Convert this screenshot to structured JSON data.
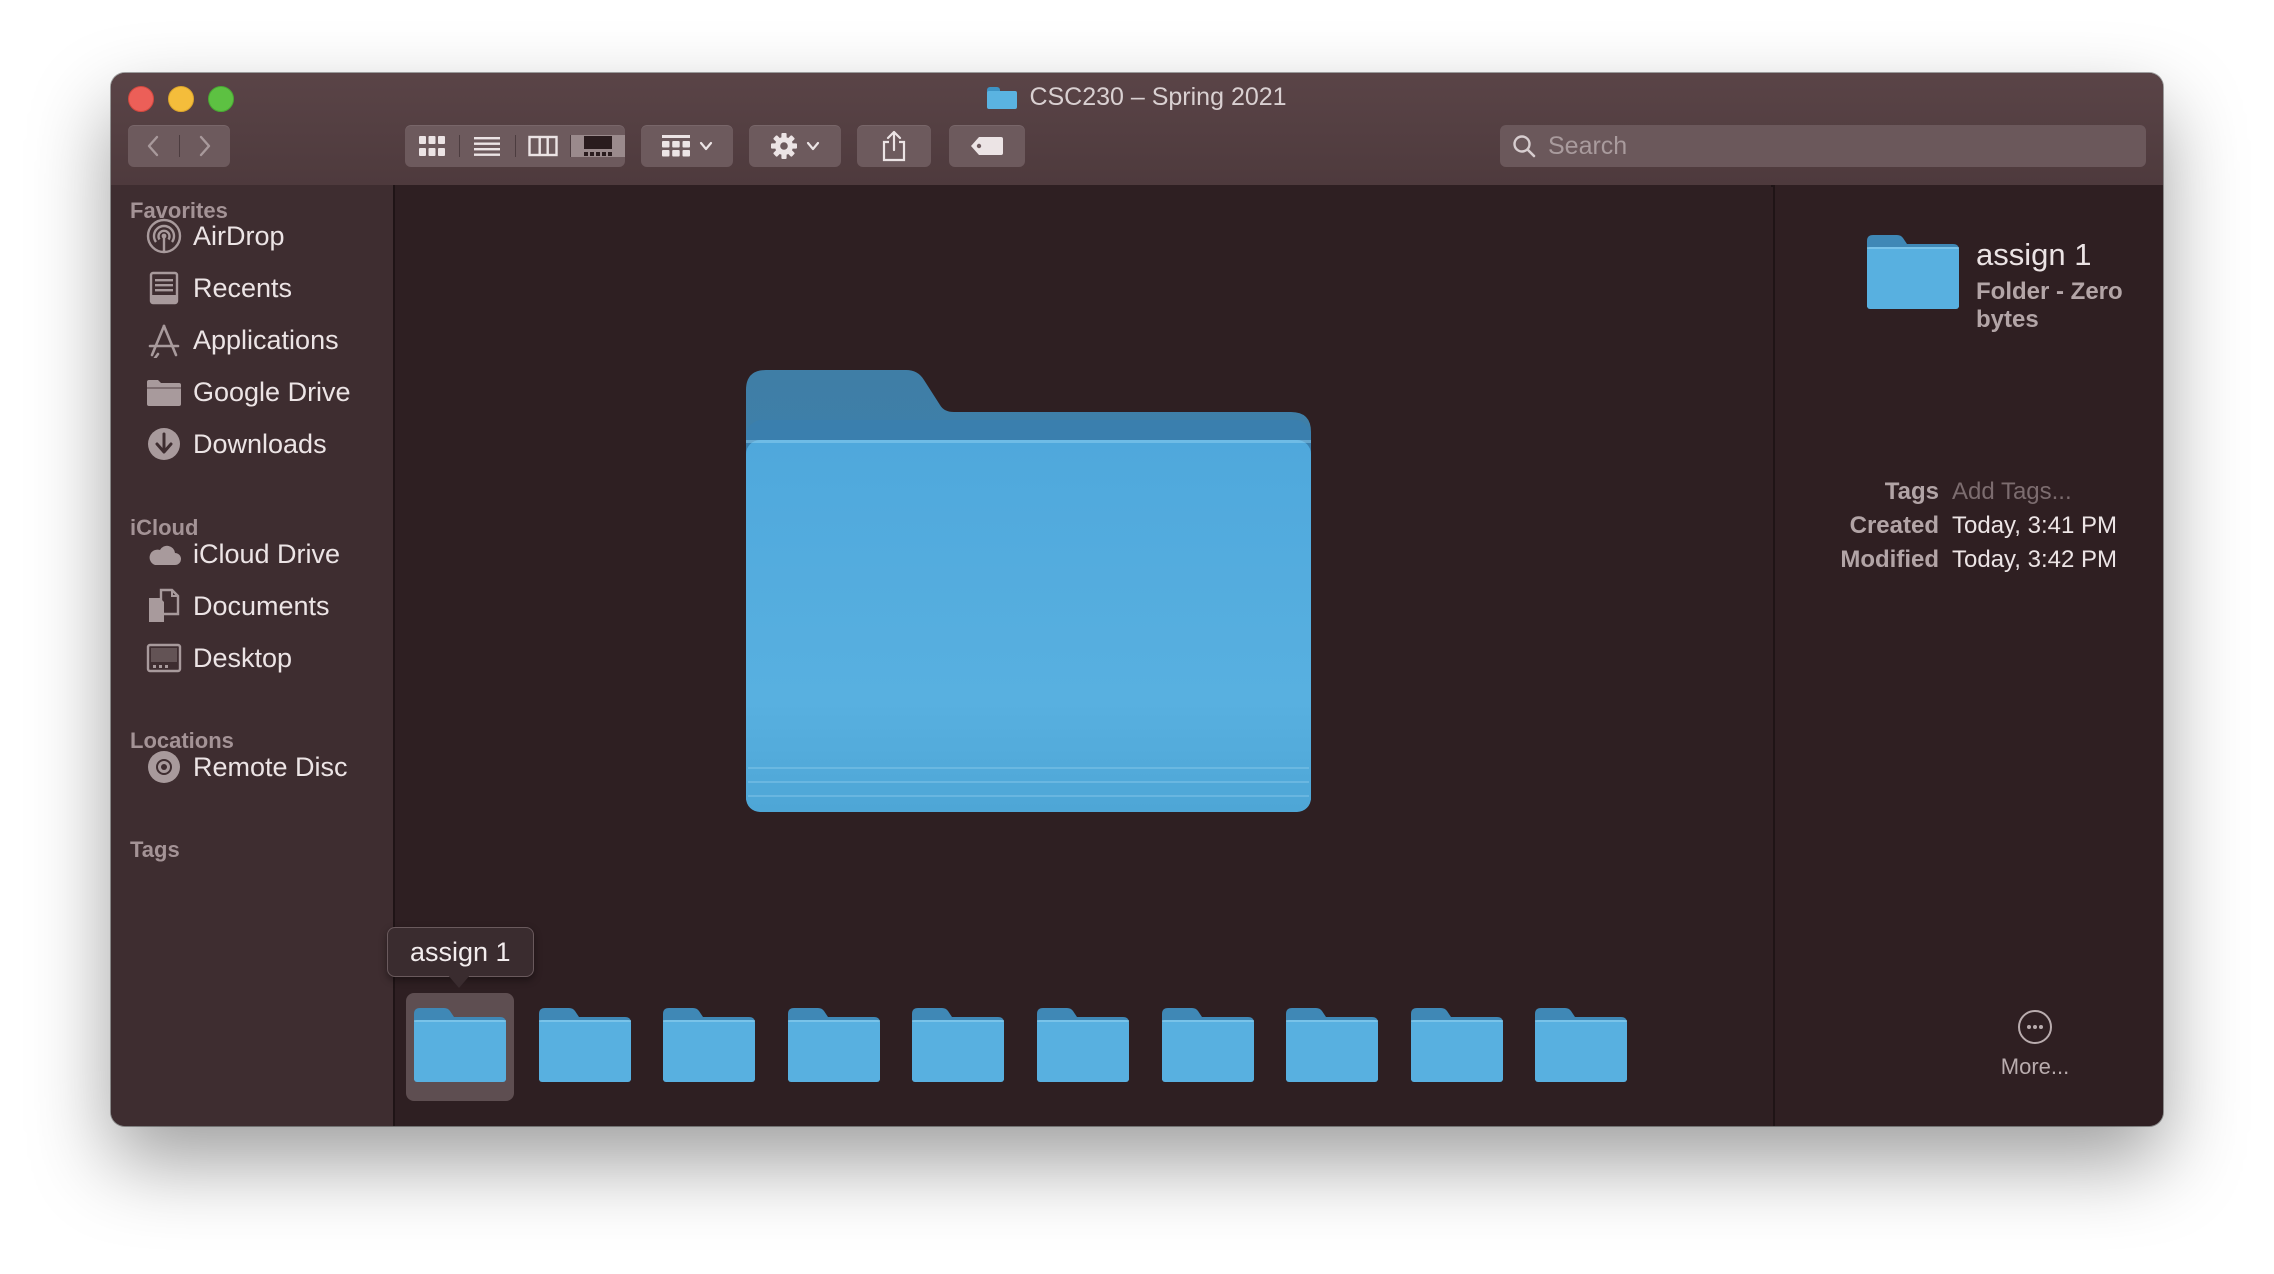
{
  "window": {
    "title": "CSC230 – Spring 2021",
    "title_icon": "folder-icon"
  },
  "toolbar": {
    "back_icon": "chevron-left-icon",
    "forward_icon": "chevron-right-icon",
    "view_modes": [
      {
        "id": "icon",
        "icon": "grid-icon",
        "active": false
      },
      {
        "id": "list",
        "icon": "list-icon",
        "active": false
      },
      {
        "id": "columns",
        "icon": "columns-icon",
        "active": false
      },
      {
        "id": "gallery",
        "icon": "gallery-icon",
        "active": true
      }
    ],
    "group_icon": "group-grid-icon",
    "action_icon": "gear-icon",
    "share_icon": "share-icon",
    "tag_icon": "tag-icon",
    "search_placeholder": "Search"
  },
  "sidebar": {
    "sections": [
      {
        "header": "Favorites",
        "items": [
          {
            "label": "AirDrop",
            "icon": "airdrop-icon"
          },
          {
            "label": "Recents",
            "icon": "recents-icon"
          },
          {
            "label": "Applications",
            "icon": "applications-icon"
          },
          {
            "label": "Google Drive",
            "icon": "folder-icon"
          },
          {
            "label": "Downloads",
            "icon": "downloads-icon"
          }
        ]
      },
      {
        "header": "iCloud",
        "items": [
          {
            "label": "iCloud Drive",
            "icon": "cloud-icon"
          },
          {
            "label": "Documents",
            "icon": "documents-icon"
          },
          {
            "label": "Desktop",
            "icon": "desktop-icon"
          }
        ]
      },
      {
        "header": "Locations",
        "items": [
          {
            "label": "Remote Disc",
            "icon": "disc-icon"
          }
        ]
      },
      {
        "header": "Tags",
        "items": []
      }
    ]
  },
  "gallery": {
    "tooltip": "assign 1",
    "selected_index": 0,
    "item_count": 10
  },
  "inspector": {
    "name": "assign 1",
    "kind": "Folder - Zero bytes",
    "meta": [
      {
        "key": "Tags",
        "value": "Add Tags...",
        "placeholder": true
      },
      {
        "key": "Created",
        "value": "Today, 3:41 PM",
        "placeholder": false
      },
      {
        "key": "Modified",
        "value": "Today, 3:42 PM",
        "placeholder": false
      }
    ],
    "more_label": "More..."
  },
  "colors": {
    "folder_front": "#58b0e0",
    "folder_back": "#3e88b6",
    "window_bg": "#2f1f22",
    "sidebar_bg": "#3e2d30",
    "toolbar_bg": "#54403f"
  }
}
